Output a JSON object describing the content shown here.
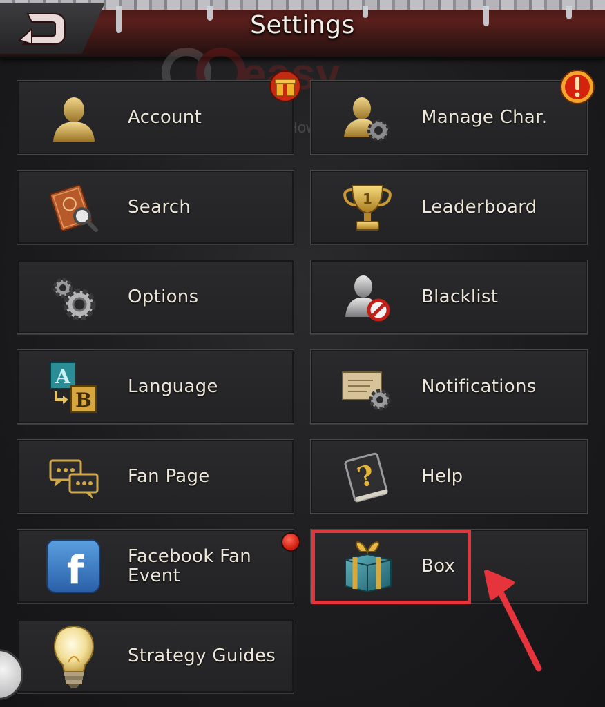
{
  "header": {
    "title": "Settings",
    "back_icon": "back-arrow-icon"
  },
  "watermark": {
    "brand": "easy",
    "tagline": "How life should be"
  },
  "menu": {
    "account": {
      "label": "Account",
      "icon": "user-silhouette-icon",
      "badge_icon": "gift-badge-icon"
    },
    "manage_char": {
      "label": "Manage Char.",
      "icon": "user-gear-icon",
      "badge_icon": "alert-badge-icon"
    },
    "search": {
      "label": "Search",
      "icon": "book-magnifier-icon"
    },
    "leaderboard": {
      "label": "Leaderboard",
      "icon": "trophy-icon",
      "trophy_number": "1"
    },
    "options": {
      "label": "Options",
      "icon": "gears-icon"
    },
    "blacklist": {
      "label": "Blacklist",
      "icon": "user-blocked-icon"
    },
    "language": {
      "label": "Language",
      "icon": "language-ab-icon",
      "letter_a": "A",
      "letter_b": "B"
    },
    "notifications": {
      "label": "Notifications",
      "icon": "letter-gear-icon"
    },
    "fan_page": {
      "label": "Fan Page",
      "icon": "chat-bubbles-icon"
    },
    "help": {
      "label": "Help",
      "icon": "help-book-icon",
      "glyph": "?"
    },
    "facebook": {
      "label_line1": "Facebook Fan",
      "label_line2": "Event",
      "icon": "facebook-icon",
      "icon_letter": "f"
    },
    "box": {
      "label": "Box",
      "icon": "gift-box-icon"
    },
    "strategy": {
      "label": "Strategy Guides",
      "icon": "lightbulb-icon"
    }
  },
  "colors": {
    "highlight": "#e6343d",
    "notification_dot": "#d42214",
    "gold": "#c9a24a",
    "text": "#ece6da"
  }
}
